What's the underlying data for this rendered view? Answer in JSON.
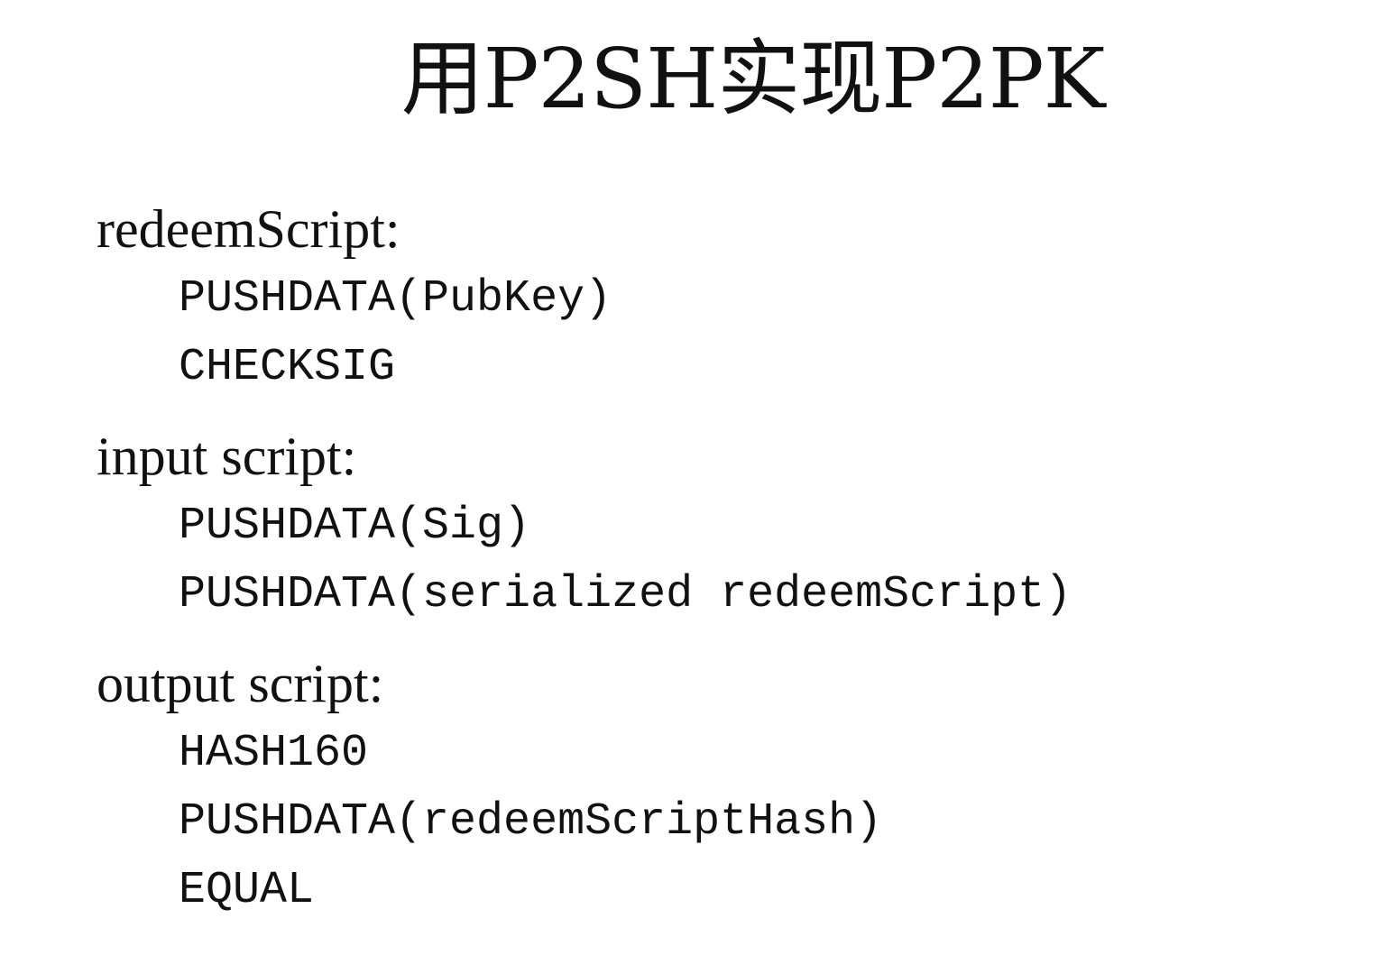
{
  "slide": {
    "title": "用P2SH实现P2PK",
    "sections": [
      {
        "heading": "redeemScript:",
        "lines": [
          "PUSHDATA(PubKey)",
          "CHECKSIG"
        ]
      },
      {
        "heading": "input script:",
        "lines": [
          "PUSHDATA(Sig)",
          "PUSHDATA(serialized redeemScript)"
        ]
      },
      {
        "heading": "output script:",
        "lines": [
          "HASH160",
          "PUSHDATA(redeemScriptHash)",
          "EQUAL"
        ]
      }
    ]
  }
}
